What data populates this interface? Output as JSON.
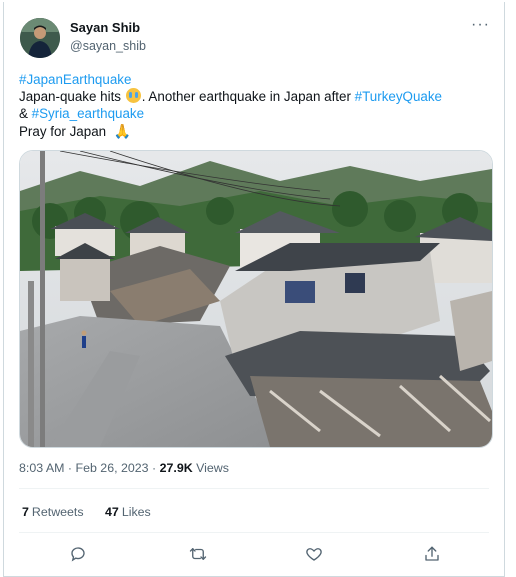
{
  "author": {
    "display_name": "Sayan Shib",
    "handle": "@sayan_shib"
  },
  "tweet": {
    "hashtag_top": "#JapanEarthquake",
    "line2_pre": "Japan-quake hits",
    "line2_mid": ". Another earthquake in Japan after",
    "hashtag_turkey": "#TurkeyQuake",
    "line3_amp": "&",
    "hashtag_syria": "#Syria_earthquake",
    "line4": "Pray for Japan",
    "emojis": [
      "loudly-crying-face",
      "folded-hands"
    ]
  },
  "meta": {
    "time": "8:03 AM",
    "separator": "·",
    "date": "Feb 26, 2023",
    "separator2": "·",
    "views_count": "27.9K",
    "views_label": "Views"
  },
  "stats": {
    "retweets_count": "7",
    "retweets_label": "Retweets",
    "likes_count": "47",
    "likes_label": "Likes"
  },
  "actions": [
    "reply-icon",
    "retweet-icon",
    "like-icon",
    "share-icon"
  ],
  "colors": {
    "link": "#1d9bf0",
    "secondary_text": "#536471",
    "border": "#cfd9de"
  }
}
